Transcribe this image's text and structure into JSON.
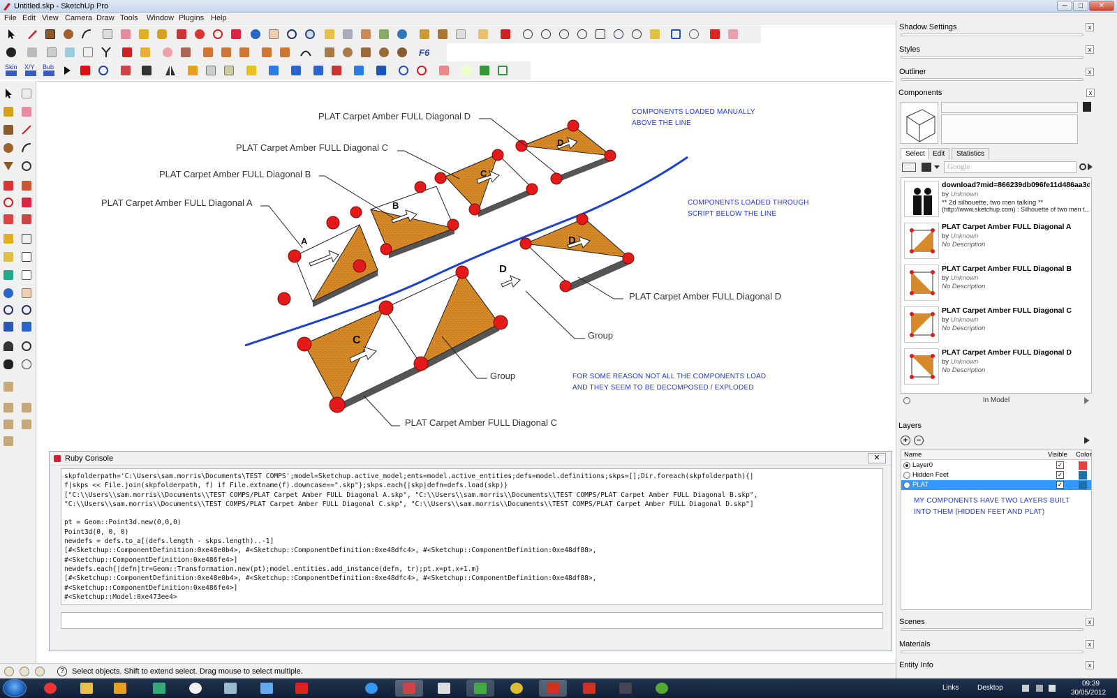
{
  "window": {
    "title": "Untitled.skp - SketchUp Pro",
    "min": "─",
    "max": "□",
    "close": "✕"
  },
  "menu": [
    "File",
    "Edit",
    "View",
    "Camera",
    "Draw",
    "Tools",
    "Window",
    "Plugins",
    "Help"
  ],
  "toolbar_text": {
    "skin": "Skin",
    "xyz": "X/Y",
    "bub": "Bub",
    "fs": "F6"
  },
  "canvas": {
    "notes": {
      "manual_l1": "COMPONENTS LOADED MANUALLY",
      "manual_l2": "ABOVE THE LINE",
      "script_l1": "COMPONENTS LOADED THROUGH",
      "script_l2": "SCRIPT BELOW THE LINE",
      "reason_l1": "FOR SOME REASON NOT ALL THE COMPONENTS LOAD",
      "reason_l2": "AND THEY SEEM TO BE DECOMPOSED / EXPLODED"
    },
    "labels": {
      "diag_d_top": "PLAT Carpet Amber FULL Diagonal D",
      "diag_c_top": "PLAT Carpet Amber FULL Diagonal C",
      "diag_b_top": "PLAT Carpet Amber FULL Diagonal B",
      "diag_a_top": "PLAT Carpet Amber FULL Diagonal A",
      "diag_d_bottom": "PLAT Carpet Amber FULL Diagonal D",
      "group1": "Group",
      "group2": "Group",
      "diag_c_bottom": "PLAT Carpet Amber FULL Diagonal C"
    },
    "tile_letters": {
      "a": "A",
      "b": "B",
      "c": "C",
      "d": "D",
      "d2": "D",
      "d3": "D",
      "c2": "C"
    }
  },
  "console": {
    "title": "Ruby Console",
    "close": "✕",
    "lines": [
      "skpfolderpath='C:\\Users\\sam.morris\\Documents\\TEST COMPS';model=Sketchup.active_model;ents=model.active_entities;defs=model.definitions;skps=[];Dir.foreach(skpfolderpath){|",
      "f|skps << File.join(skpfolderpath, f) if File.extname(f).downcase==\".skp\"};skps.each{|skp|defn=defs.load(skp)}",
      "[\"C:\\\\Users\\\\sam.morris\\\\Documents\\\\TEST COMPS/PLAT Carpet Amber FULL Diagonal A.skp\", \"C:\\\\Users\\\\sam.morris\\\\Documents\\\\TEST COMPS/PLAT Carpet Amber FULL Diagonal B.skp\",",
      "\"C:\\\\Users\\\\sam.morris\\\\Documents\\\\TEST COMPS/PLAT Carpet Amber FULL Diagonal C.skp\", \"C:\\\\Users\\\\sam.morris\\\\Documents\\\\TEST COMPS/PLAT Carpet Amber FULL Diagonal D.skp\"]",
      " ",
      "pt = Geom::Point3d.new(0,0,0)",
      "Point3d(0, 0, 0)",
      "newdefs = defs.to_a[(defs.length - skps.length)..-1]",
      "[#<Sketchup::ComponentDefinition:0xe48e0b4>, #<Sketchup::ComponentDefinition:0xe48dfc4>, #<Sketchup::ComponentDefinition:0xe48df88>,",
      "#<Sketchup::ComponentDefinition:0xe486fe4>]",
      "newdefs.each{|defn|tr=Geom::Transformation.new(pt);model.entities.add_instance(defn, tr);pt.x=pt.x+1.m}",
      "[#<Sketchup::ComponentDefinition:0xe48e0b4>, #<Sketchup::ComponentDefinition:0xe48dfc4>, #<Sketchup::ComponentDefinition:0xe48df88>,",
      "#<Sketchup::ComponentDefinition:0xe486fe4>]",
      "#<Sketchup::Model:0xe473ee4>"
    ]
  },
  "status": {
    "message": "Select objects. Shift to extend select. Drag mouse to select multiple."
  },
  "panels": {
    "shadow": "Shadow Settings",
    "styles": "Styles",
    "outliner": "Outliner",
    "components": "Components",
    "scenes": "Scenes",
    "materials": "Materials",
    "entity_info": "Entity Info",
    "close": "x"
  },
  "components": {
    "tabs": [
      "Select",
      "Edit",
      "Statistics"
    ],
    "search_placeholder": "Google",
    "footer": "In Model",
    "items": [
      {
        "name": "download?mid=866239db096fe11d486aa3d6...",
        "by": "by",
        "author": "Unknown",
        "desc": "** 2d silhouette, two men talking **",
        "desc2": "(http://www.sketchup.com) :  Silhouette of two men t..."
      },
      {
        "name": "PLAT Carpet Amber FULL Diagonal A",
        "by": "by",
        "author": "Unknown",
        "desc": "No Description",
        "desc2": ""
      },
      {
        "name": "PLAT Carpet Amber FULL Diagonal B",
        "by": "by",
        "author": "Unknown",
        "desc": "No Description",
        "desc2": ""
      },
      {
        "name": "PLAT Carpet Amber FULL Diagonal C",
        "by": "by",
        "author": "Unknown",
        "desc": "No Description",
        "desc2": ""
      },
      {
        "name": "PLAT Carpet Amber FULL Diagonal D",
        "by": "by",
        "author": "Unknown",
        "desc": "No Description",
        "desc2": ""
      }
    ]
  },
  "layers": {
    "title": "Layers",
    "col_name": "Name",
    "col_visible": "Visible",
    "col_color": "Color",
    "rows": [
      {
        "name": "Layer0",
        "active": true,
        "visible": true,
        "color": "#e8413c"
      },
      {
        "name": "Hidden Feet",
        "active": false,
        "visible": true,
        "color": "#1f6fa8"
      },
      {
        "name": "PLAT",
        "active": false,
        "visible": true,
        "color": "#1f6fa8"
      }
    ],
    "note_l1": "MY COMPONENTS HAVE TWO LAYERS BUILT",
    "note_l2": "INTO THEM (HIDDEN FEET AND PLAT)"
  },
  "taskbar": {
    "links": "Links",
    "desktop": "Desktop",
    "time": "09:39",
    "date": "30/05/2012"
  }
}
